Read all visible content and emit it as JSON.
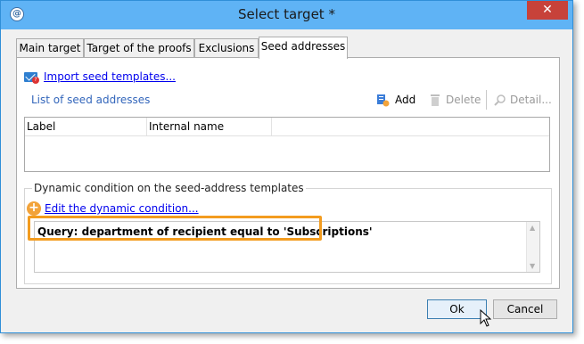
{
  "window": {
    "title": "Select target *",
    "close_label": "✕"
  },
  "tabs": [
    {
      "label": "Main target"
    },
    {
      "label": "Target of the proofs"
    },
    {
      "label": "Exclusions"
    },
    {
      "label": "Seed addresses",
      "active": true
    }
  ],
  "seed": {
    "import_link": "Import seed templates...",
    "list_label": "List of seed addresses",
    "toolbar": {
      "add": "Add",
      "delete": "Delete",
      "detail": "Detail..."
    },
    "columns": [
      "Label",
      "Internal name"
    ]
  },
  "dynamic": {
    "group_label": "Dynamic condition on the seed-address templates",
    "edit_link": "Edit the dynamic condition...",
    "query": "Query: department of recipient equal to 'Subscriptions'"
  },
  "buttons": {
    "ok": "Ok",
    "cancel": "Cancel"
  },
  "colors": {
    "titlebar": "#5fb3f5",
    "close": "#c7423a",
    "highlight": "#f39c1f",
    "link": "#0000ee"
  }
}
